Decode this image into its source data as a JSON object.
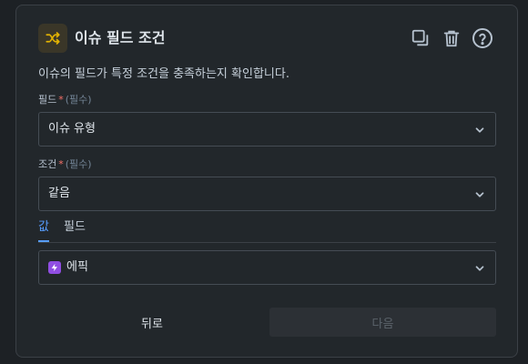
{
  "header": {
    "title": "이슈 필드 조건",
    "icons": [
      "shuffle-icon",
      "duplicate-icon",
      "trash-icon",
      "help-icon"
    ]
  },
  "description": "이슈의 필드가 특정 조건을 충족하는지 확인합니다.",
  "field": {
    "label": "필드",
    "required_mark": "*",
    "hint": "(필수)",
    "value": "이슈 유형"
  },
  "condition": {
    "label": "조건",
    "required_mark": "*",
    "hint": "(필수)",
    "value": "같음"
  },
  "tabs": [
    {
      "label": "값",
      "active": true
    },
    {
      "label": "필드",
      "active": false
    }
  ],
  "value_select": {
    "value": "에픽",
    "icon": "lightning-icon",
    "icon_color": "#904ee2"
  },
  "footer": {
    "back_label": "뒤로",
    "next_label": "다음"
  },
  "colors": {
    "accent": "#579dff",
    "required": "#f87168",
    "app_icon": "#e2b203"
  }
}
